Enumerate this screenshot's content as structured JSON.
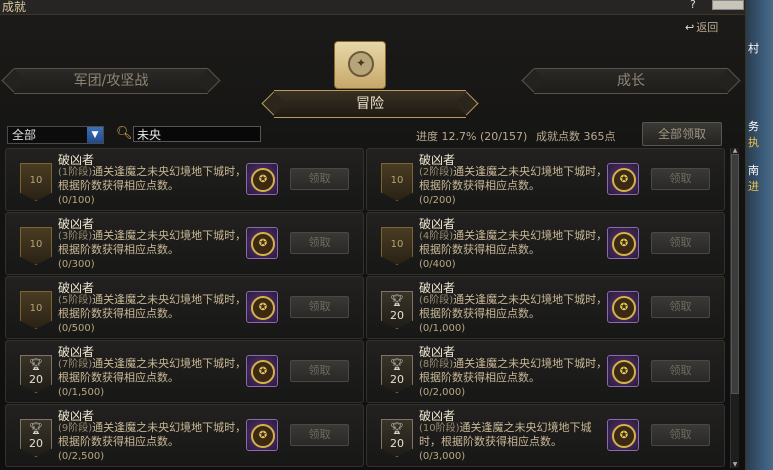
{
  "window": {
    "title": "成就",
    "help_glyph": "?",
    "return_label": "返回",
    "return_glyph": "↩"
  },
  "categories": {
    "legion": "军团/攻坚战",
    "adventure": "冒险",
    "growth": "成长"
  },
  "filter": {
    "selected": "全部"
  },
  "search": {
    "value": "未央"
  },
  "progress": {
    "label": "进度",
    "percent": "12.7%",
    "count": "(20/157)"
  },
  "points": {
    "label": "成就点数",
    "value": "365点"
  },
  "claim_all_label": "全部领取",
  "achievements": [
    {
      "name": "破凶者",
      "stage": "(1阶段)",
      "desc": "通关逢魔之未央幻境地下城时，根据阶数获得相应点数。",
      "progress": "(0/100)",
      "badge": "10",
      "trophy": false,
      "claim": "领取"
    },
    {
      "name": "破凶者",
      "stage": "(2阶段)",
      "desc": "通关逢魔之未央幻境地下城时，根据阶数获得相应点数。",
      "progress": "(0/200)",
      "badge": "10",
      "trophy": false,
      "claim": "领取"
    },
    {
      "name": "破凶者",
      "stage": "(3阶段)",
      "desc": "通关逢魔之未央幻境地下城时，根据阶数获得相应点数。",
      "progress": "(0/300)",
      "badge": "10",
      "trophy": false,
      "claim": "领取"
    },
    {
      "name": "破凶者",
      "stage": "(4阶段)",
      "desc": "通关逢魔之未央幻境地下城时，根据阶数获得相应点数。",
      "progress": "(0/400)",
      "badge": "10",
      "trophy": false,
      "claim": "领取"
    },
    {
      "name": "破凶者",
      "stage": "(5阶段)",
      "desc": "通关逢魔之未央幻境地下城时，根据阶数获得相应点数。",
      "progress": "(0/500)",
      "badge": "10",
      "trophy": false,
      "claim": "领取"
    },
    {
      "name": "破凶者",
      "stage": "(6阶段)",
      "desc": "通关逢魔之未央幻境地下城时，根据阶数获得相应点数。",
      "progress": "(0/1,000)",
      "badge": "20",
      "trophy": true,
      "claim": "领取"
    },
    {
      "name": "破凶者",
      "stage": "(7阶段)",
      "desc": "通关逢魔之未央幻境地下城时，根据阶数获得相应点数。",
      "progress": "(0/1,500)",
      "badge": "20",
      "trophy": true,
      "claim": "领取"
    },
    {
      "name": "破凶者",
      "stage": "(8阶段)",
      "desc": "通关逢魔之未央幻境地下城时，根据阶数获得相应点数。",
      "progress": "(0/2,000)",
      "badge": "20",
      "trophy": true,
      "claim": "领取"
    },
    {
      "name": "破凶者",
      "stage": "(9阶段)",
      "desc": "通关逢魔之未央幻境地下城时，根据阶数获得相应点数。",
      "progress": "(0/2,500)",
      "badge": "20",
      "trophy": true,
      "claim": "领取"
    },
    {
      "name": "破凶者",
      "stage": "(10阶段)",
      "desc": "通关逢魔之未央幻境地下城时，根据阶数获得相应点数。",
      "progress": "(0/3,000)",
      "badge": "20",
      "trophy": true,
      "claim": "领取"
    }
  ],
  "right_strip": {
    "lines": [
      "村",
      "务",
      "执",
      "南",
      "进"
    ]
  }
}
